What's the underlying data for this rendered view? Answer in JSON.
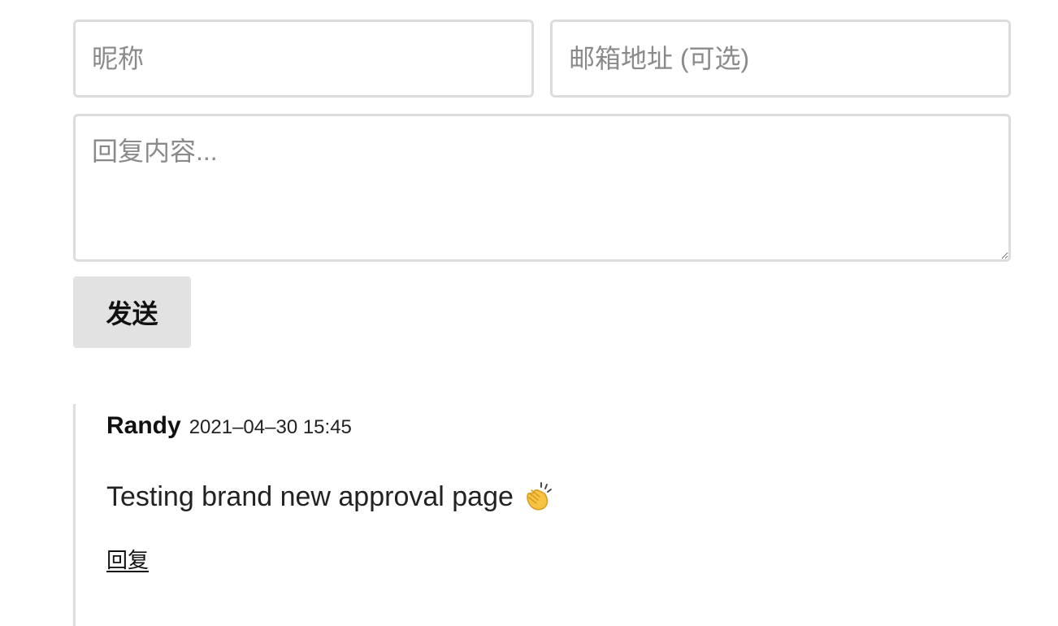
{
  "form": {
    "nickname_placeholder": "昵称",
    "email_placeholder": "邮箱地址 (可选)",
    "content_placeholder": "回复内容...",
    "send_label": "发送"
  },
  "comments": [
    {
      "author": "Randy",
      "date": "2021–04–30 15:45",
      "body": "Testing brand new approval page",
      "emoji_icon": "clapping-hands-icon",
      "reply_label": "回复"
    }
  ],
  "colors": {
    "border": "#dcdcdc",
    "button_bg": "#e2e2e2",
    "quote_border": "#dedede"
  }
}
